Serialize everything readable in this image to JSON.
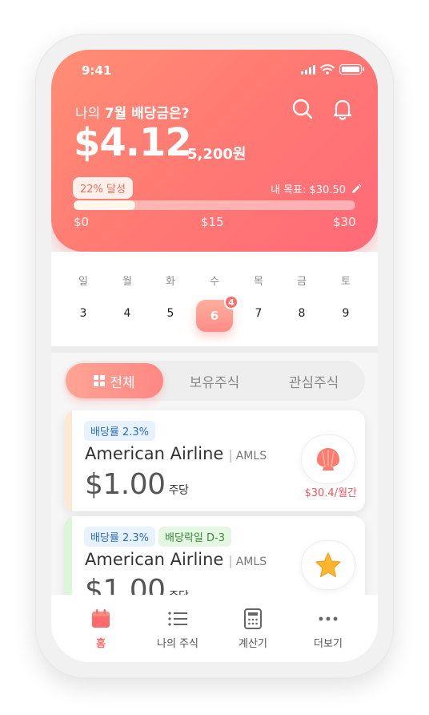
{
  "status": {
    "time": "9:41"
  },
  "header": {
    "question_prefix": "나의 ",
    "question_highlight": "7월 배당금은?",
    "amount_usd": "$4.12",
    "amount_krw": "5,200원",
    "achievement": "22% 달성",
    "goal_label": "내 목표: $30.50",
    "progress_percent": 22,
    "ticks": [
      "$0",
      "$15",
      "$30"
    ]
  },
  "calendar": {
    "weekdays": [
      "일",
      "월",
      "화",
      "수",
      "목",
      "금",
      "토"
    ],
    "dates": [
      "3",
      "4",
      "5",
      "6",
      "7",
      "8",
      "9"
    ],
    "selected_index": 3,
    "selected_badge": "4"
  },
  "tabs": [
    {
      "label": "전체",
      "active": true
    },
    {
      "label": "보유주식",
      "active": false
    },
    {
      "label": "관심주식",
      "active": false
    }
  ],
  "cards": [
    {
      "tags": [
        "배당률 2.3%"
      ],
      "name": "American Airline",
      "ticker": "AMLS",
      "price": "$1.00",
      "per": "주당",
      "icon": "shell-icon",
      "monthly": "$30.4/월간"
    },
    {
      "tags": [
        "배당률 2.3%",
        "배당락일 D-3"
      ],
      "name": "American Airline",
      "ticker": "AMLS",
      "price": "$1.00",
      "per": "주당",
      "icon": "star-icon"
    }
  ],
  "nav": [
    {
      "label": "홈",
      "icon": "calendar-icon",
      "active": true
    },
    {
      "label": "나의 주식",
      "icon": "list-icon",
      "active": false
    },
    {
      "label": "계산기",
      "icon": "calculator-icon",
      "active": false
    },
    {
      "label": "더보기",
      "icon": "more-icon",
      "active": false
    }
  ],
  "colors": {
    "accent": "#ff7b73",
    "alert": "#f0555f",
    "card1_bar": "#fde9d3",
    "card2_bar": "#dcf7d8"
  }
}
